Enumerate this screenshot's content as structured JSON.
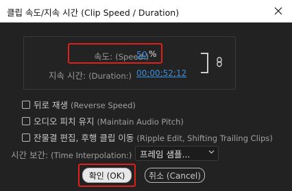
{
  "window": {
    "title": "클립 속도/지속 시간 (Clip Speed / Duration)"
  },
  "speed": {
    "label_ko": "속도:",
    "label_en": "(Speed:)",
    "value": "50",
    "unit": "%"
  },
  "duration": {
    "label_ko": "지속 시간:",
    "label_en": "(Duration:)",
    "value": "00;00;52;12"
  },
  "options": [
    {
      "label_ko": "뒤로 재생",
      "label_en": "(Reverse Speed)",
      "checked": false
    },
    {
      "label_ko": "오디오 피치 유지",
      "label_en": "(Maintain Audio Pitch)",
      "checked": false
    },
    {
      "label_ko": "잔물결 편집, 후행 클립 이동",
      "label_en": "(Ripple Edit, Shifting Trailing Clips)",
      "checked": false
    }
  ],
  "interpolation": {
    "label_ko": "시간 보간:",
    "label_en": "(Time Interpolation:)",
    "selected": "프레임 샘플..."
  },
  "buttons": {
    "ok_label": "확인 (OK)",
    "cancel_label": "취소 (Cancel)"
  },
  "icons": {
    "close": "close-icon",
    "link": "link-icon",
    "dropdown": "chevron-down-icon"
  },
  "colors": {
    "background": "#222222",
    "link_value": "#3a8fe0",
    "highlight_box": "#e0201b"
  }
}
